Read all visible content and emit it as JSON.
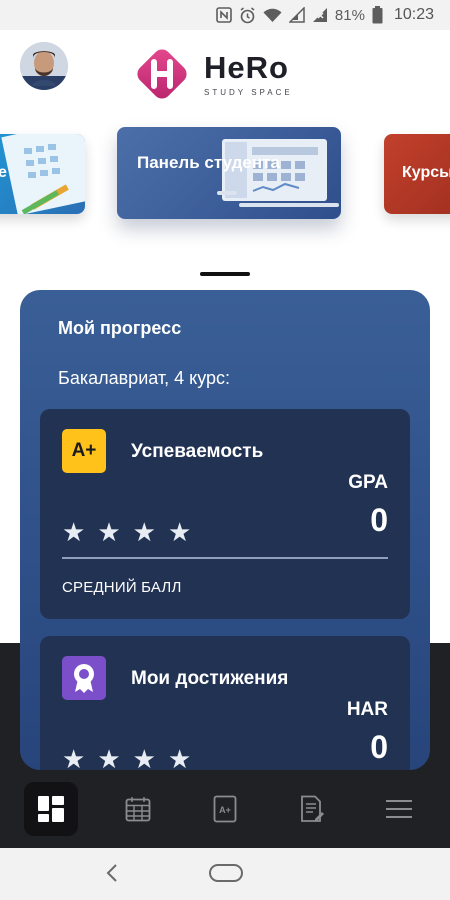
{
  "status_bar": {
    "battery_percent": "81%",
    "time": "10:23",
    "icons": [
      "nfc-icon",
      "alarm-icon",
      "wifi-icon",
      "signal-icon",
      "battery-icon"
    ]
  },
  "header": {
    "logo_title": "HeRo",
    "logo_subtitle": "STUDY SPACE"
  },
  "carousel": {
    "cards": [
      {
        "label": "е"
      },
      {
        "label": "Панель студента"
      },
      {
        "label": "Курсы"
      }
    ]
  },
  "progress": {
    "title": "Мой прогресс",
    "subtitle": "Бакалавриат, 4 курс:",
    "cards": [
      {
        "badge": "A+",
        "title": "Успеваемость",
        "code": "GPA",
        "value": "0",
        "footer": "СРЕДНИЙ БАЛЛ",
        "stars": 4
      },
      {
        "badge": "ribbon-icon",
        "title": "Мои достижения",
        "code": "HAR",
        "value": "0",
        "stars": 4
      }
    ]
  },
  "bottom_nav": {
    "items": [
      {
        "icon": "dashboard-icon",
        "active": true
      },
      {
        "icon": "calendar-icon",
        "active": false
      },
      {
        "icon": "grades-icon",
        "label": "A+",
        "active": false
      },
      {
        "icon": "document-edit-icon",
        "active": false
      },
      {
        "icon": "menu-icon",
        "active": false
      }
    ]
  },
  "colors": {
    "panel": "#30518a",
    "card": "#223253",
    "badge_yellow": "#ffc21a",
    "badge_purple": "#7b4fc9",
    "logo_pink": "#d63384"
  }
}
